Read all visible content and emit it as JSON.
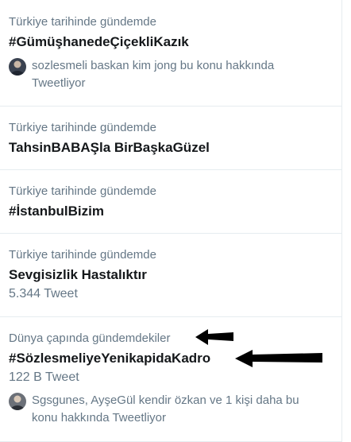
{
  "trends": [
    {
      "context": "Türkiye tarihinde gündemde",
      "title": "#GümüşhanedeÇiçekliKazık",
      "tweeters": "sozlesmeli baskan kim jong bu konu hakkında Tweetliyor"
    },
    {
      "context": "Türkiye tarihinde gündemde",
      "title": "TahsinBABAŞla BirBaşkaGüzel"
    },
    {
      "context": "Türkiye tarihinde gündemde",
      "title": "#İstanbulBizim"
    },
    {
      "context": "Türkiye tarihinde gündemde",
      "title": "Sevgisizlik Hastalıktır",
      "count": "5.344 Tweet"
    },
    {
      "context": "Dünya çapında gündemdekiler",
      "title": "#SözlesmeliyeYenikapidaKadro",
      "count": "122 B Tweet",
      "tweeters": "Sgsgunes, AyşeGül kendir özkan ve 1 kişi daha bu konu hakkında Tweetliyor"
    }
  ],
  "colors": {
    "secondary_text": "#657786",
    "primary_text": "#14171a",
    "divider": "#e6ecf0",
    "annotation_arrow": "#000000"
  },
  "icons": {
    "annotation": "arrow-left-icon",
    "avatar": "user-avatar-icon"
  }
}
